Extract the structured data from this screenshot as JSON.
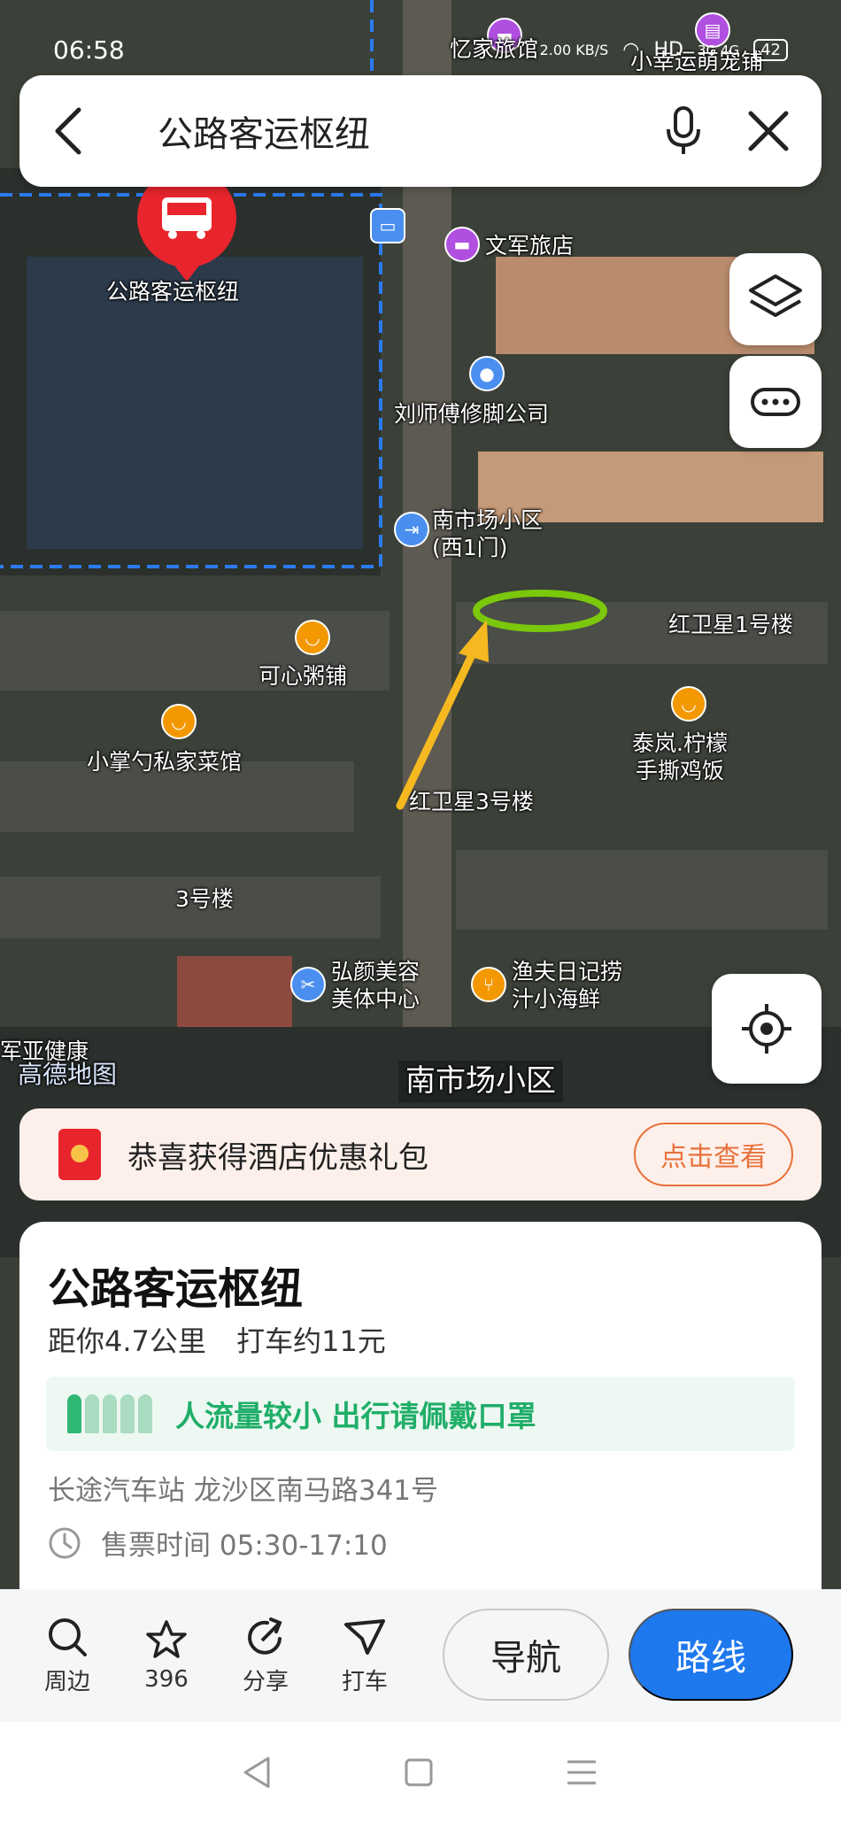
{
  "status_bar": {
    "time": "06:58",
    "network_speed": "2.00 KB/S",
    "hd_label": "HD",
    "signal_label": "3G 4G",
    "battery": "42"
  },
  "search": {
    "query": "公路客运枢纽"
  },
  "map": {
    "labels": {
      "hub": "公路客运枢纽",
      "hotel_wenjun": "文军旅店",
      "hotel_top_left": "忆家旅馆",
      "shop_top_right": "小幸运萌宠铺",
      "footcare": "刘师傅修脚公司",
      "nanshichang_west_gate": "南市场小区\n(西1门)",
      "hongweixing1": "红卫星1号楼",
      "kexin": "可心粥铺",
      "xiaozhangshao": "小掌勺私家菜馆",
      "tailan": "泰岚.柠檬\n手撕鸡饭",
      "hongweixing3": "红卫星3号楼",
      "building3": "3号楼",
      "hongyan": "弘颜美容\n美体中心",
      "yufu": "渔夫日记捞\n汁小海鲜",
      "junyajiankang": "军亚健康",
      "nanshichang": "南市场小区",
      "watermark": "高德地图"
    }
  },
  "promo": {
    "text": "恭喜获得酒店优惠礼包",
    "button": "点击查看"
  },
  "card": {
    "title": "公路客运枢纽",
    "distance": "距你4.7公里",
    "taxi": "打车约11元",
    "crowd_text": "人流量较小 出行请佩戴口罩",
    "address": "长途汽车站 龙沙区南马路341号",
    "hours": "售票时间 05:30-17:10"
  },
  "actions": {
    "nearby": "周边",
    "favorites": "396",
    "share": "分享",
    "taxi": "打车",
    "navigate": "导航",
    "route": "路线"
  },
  "colors": {
    "route_blue": "#1e78ee",
    "crowd_green": "#1fae68",
    "promo_orange": "#e9713c",
    "pin_red": "#e8252d",
    "highlight_green": "#7ac70c",
    "arrow_yellow": "#f5b820"
  }
}
